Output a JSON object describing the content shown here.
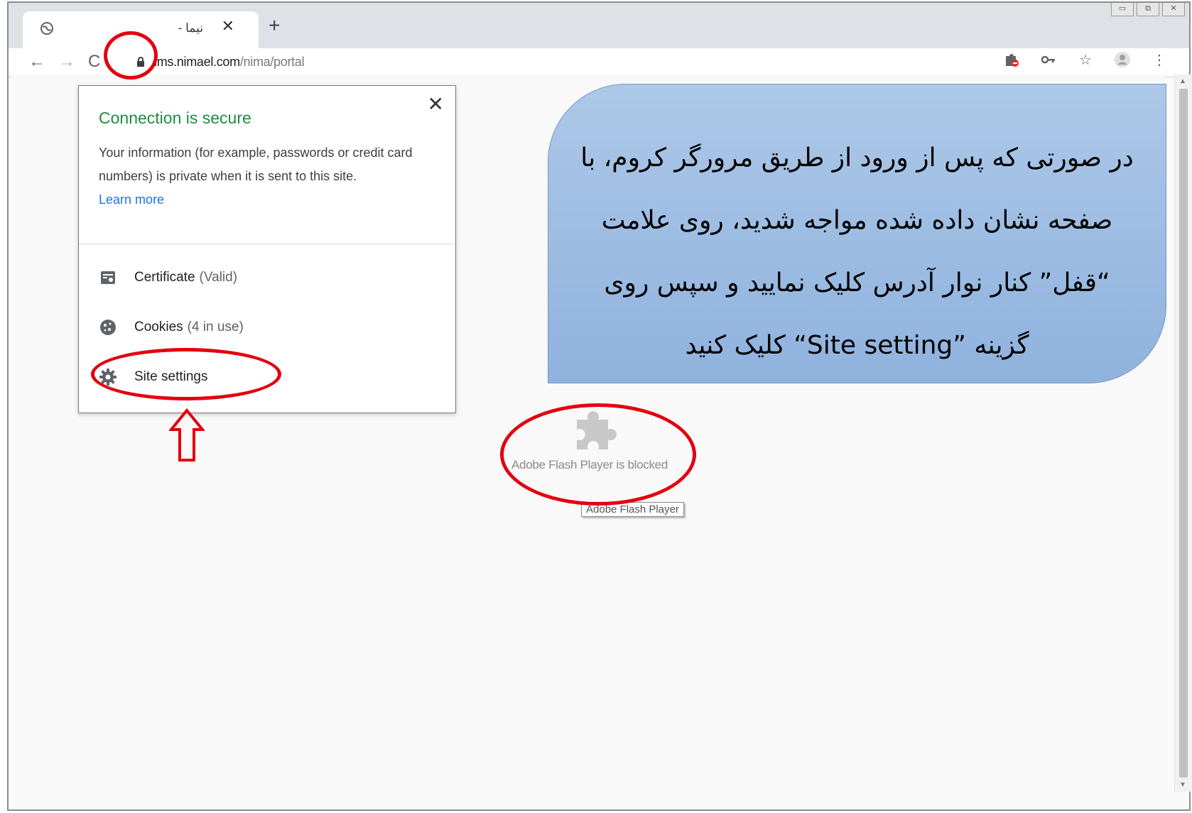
{
  "browser": {
    "tab": {
      "title": "نیما -",
      "close": "✕"
    },
    "new_tab": "+",
    "window_controls": [
      "▭",
      "⧉",
      "✕"
    ],
    "nav": {
      "back": "←",
      "forward": "→",
      "reload": "C"
    },
    "url": {
      "host": "lms.nimael.com",
      "path": "/nima/portal"
    },
    "toolbar_icons": [
      "flash-blocked-icon",
      "key-icon",
      "star-icon",
      "profile-icon",
      "menu-icon"
    ]
  },
  "popup": {
    "close": "✕",
    "heading": "Connection is secure",
    "description": "Your information (for example, passwords or credit card numbers) is private when it is sent to this site.",
    "learn_more": "Learn more",
    "items": [
      {
        "label": "Certificate",
        "sub": "(Valid)",
        "icon": "certificate-icon"
      },
      {
        "label": "Cookies",
        "sub": "(4 in use)",
        "icon": "cookie-icon"
      },
      {
        "label": "Site settings",
        "sub": "",
        "icon": "gear-icon"
      }
    ]
  },
  "callout": {
    "text": "در صورتی که پس از ورود از طریق مرورگر کروم، با صفحه نشان داده شده مواجه شدید، روی علامت “قفل” کنار نوار آدرس کلیک نمایید و سپس روی گزینه ”Site setting“ کلیک کنید"
  },
  "flash": {
    "message": "Adobe Flash Player is blocked",
    "tooltip": "Adobe Flash Player"
  },
  "colors": {
    "annotation_red": "#e3000f",
    "secure_green": "#1e8e3e",
    "link_blue": "#1a73e8",
    "callout_blue": "#9dbde3"
  }
}
